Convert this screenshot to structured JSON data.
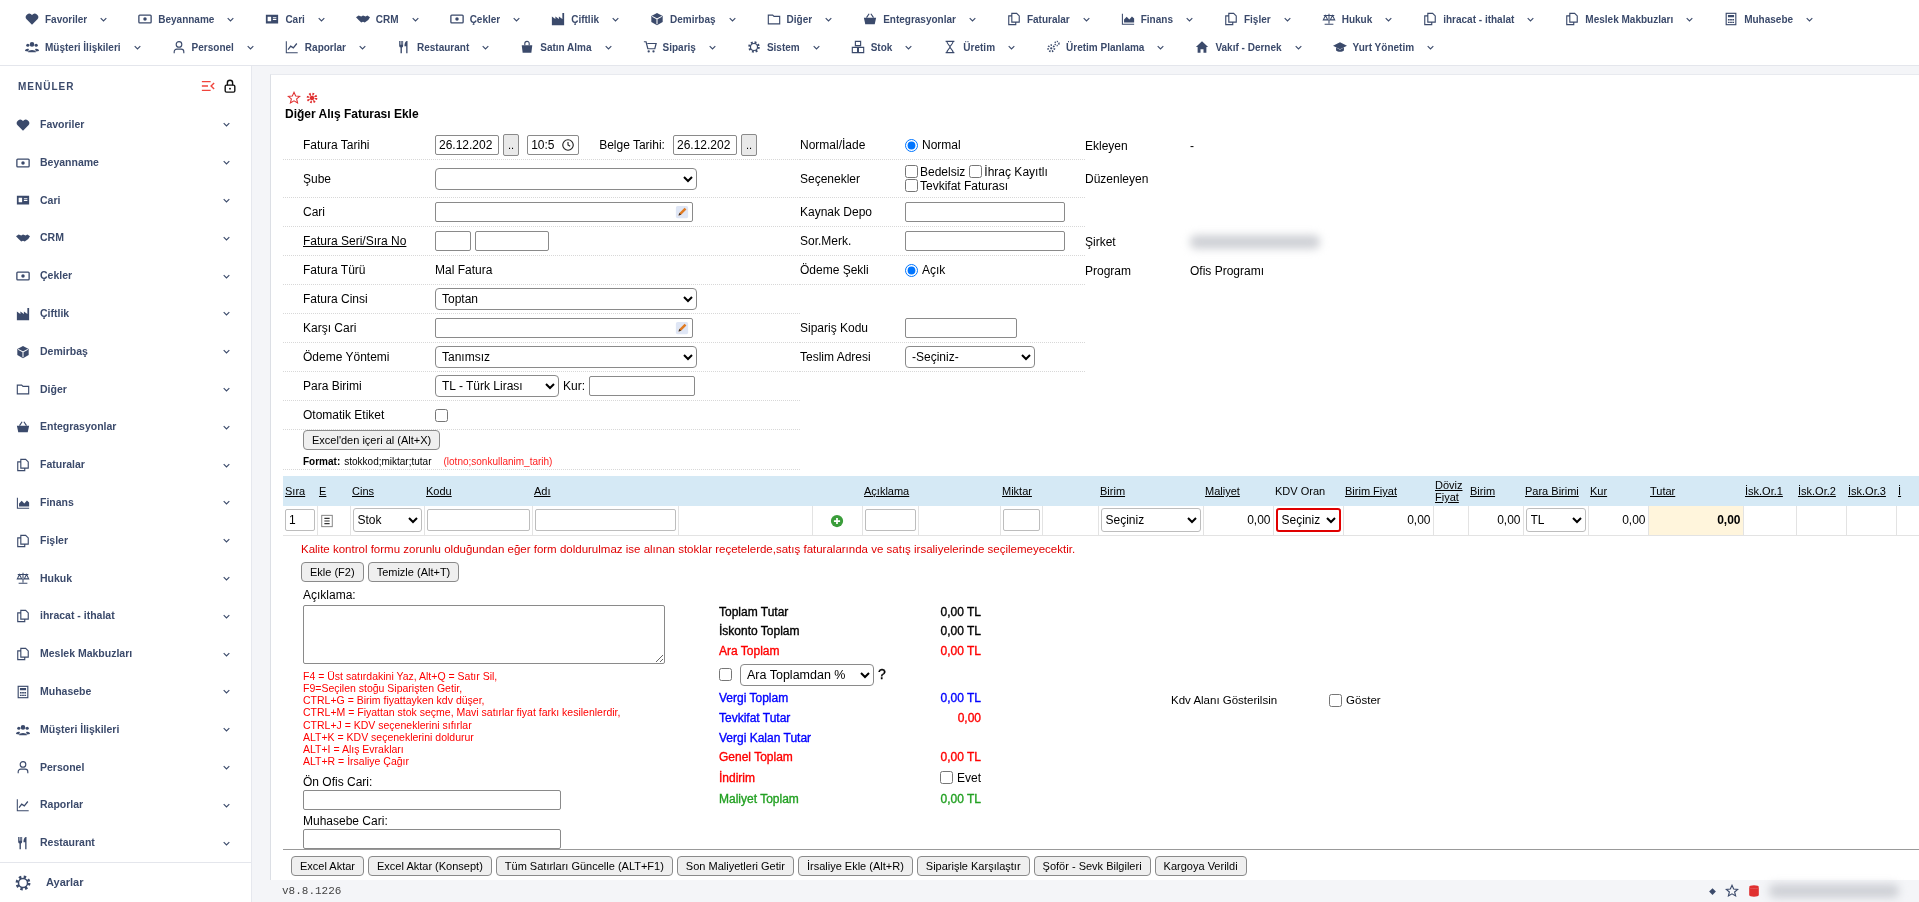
{
  "top_menu": {
    "rows": [
      {
        "items": [
          {
            "label": "Favoriler"
          },
          {
            "label": "Beyanname"
          },
          {
            "label": "Cari"
          },
          {
            "label": "CRM"
          },
          {
            "label": "Çekler"
          },
          {
            "label": "Çiftlik"
          },
          {
            "label": "Demirbaş"
          },
          {
            "label": "Diğer"
          },
          {
            "label": "Entegrasyonlar"
          },
          {
            "label": "Faturalar"
          },
          {
            "label": "Finans"
          },
          {
            "label": "Fişler"
          },
          {
            "label": "Hukuk"
          },
          {
            "label": "ihracat - ithalat"
          },
          {
            "label": "Meslek Makbuzları"
          },
          {
            "label": "Muhasebe"
          }
        ]
      },
      {
        "items": [
          {
            "label": "Müşteri İlişkileri"
          },
          {
            "label": "Personel"
          },
          {
            "label": "Raporlar"
          },
          {
            "label": "Restaurant"
          },
          {
            "label": "Satın Alma"
          },
          {
            "label": "Sipariş"
          },
          {
            "label": "Sistem"
          },
          {
            "label": "Stok"
          },
          {
            "label": "Üretim"
          },
          {
            "label": "Üretim Planlama"
          },
          {
            "label": "Vakıf - Dernek"
          },
          {
            "label": "Yurt Yönetim"
          }
        ]
      }
    ]
  },
  "sidebar": {
    "title": "MENÜLER",
    "items": [
      {
        "label": "Favoriler"
      },
      {
        "label": "Beyanname"
      },
      {
        "label": "Cari"
      },
      {
        "label": "CRM"
      },
      {
        "label": "Çekler"
      },
      {
        "label": "Çiftlik"
      },
      {
        "label": "Demirbaş"
      },
      {
        "label": "Diğer"
      },
      {
        "label": "Entegrasyonlar"
      },
      {
        "label": "Faturalar"
      },
      {
        "label": "Finans"
      },
      {
        "label": "Fişler"
      },
      {
        "label": "Hukuk"
      },
      {
        "label": "ihracat - ithalat"
      },
      {
        "label": "Meslek Makbuzları"
      },
      {
        "label": "Muhasebe"
      },
      {
        "label": "Müşteri İlişkileri"
      },
      {
        "label": "Personel"
      },
      {
        "label": "Raporlar"
      },
      {
        "label": "Restaurant"
      }
    ],
    "footer": {
      "label": "Ayarlar"
    }
  },
  "form": {
    "title": "Diğer Alış Faturası Ekle",
    "header_rows": [
      {
        "left": {
          "label": "Fatura Tarihi",
          "control": {
            "kind": "date_time",
            "date": "26.12.202",
            "button": "..",
            "time": "10:5",
            "second_label": "Belge Tarihi:",
            "second_date": "26.12.202",
            "second_button": ".."
          }
        },
        "middle": {
          "label": "Normal/İade",
          "control": {
            "kind": "radio",
            "option": "Normal",
            "selected": true
          }
        },
        "right": {
          "label": "Ekleyen",
          "value": "-"
        }
      },
      {
        "left": {
          "label": "Şube",
          "control": {
            "kind": "select_blurred"
          }
        },
        "middle": {
          "label": "Seçenekler",
          "control": {
            "kind": "checkboxes",
            "options": [
              {
                "label": "Bedelsiz",
                "checked": false
              },
              {
                "label": "İhraç Kayıtlı",
                "checked": false
              },
              {
                "label": "Tevkifat Faturası",
                "checked": false
              }
            ]
          }
        },
        "right": {
          "label": "Düzenleyen"
        }
      },
      {
        "left": {
          "label": "Cari",
          "control": {
            "kind": "lookup"
          }
        },
        "middle": {
          "label": "Kaynak Depo",
          "control": {
            "kind": "blurred_input"
          }
        }
      },
      {
        "left": {
          "label": "Fatura Seri/Sıra No",
          "link": true,
          "control": {
            "kind": "pair_inputs"
          }
        },
        "middle": {
          "label": "Sor.Merk.",
          "control": {
            "kind": "blurred_input"
          }
        },
        "right": {
          "label": "Şirket",
          "control": {
            "kind": "blurred_text"
          }
        }
      },
      {
        "left": {
          "label": "Fatura Türü",
          "control": {
            "kind": "text",
            "value": "Mal Fatura"
          }
        },
        "middle": {
          "label": "Ödeme Şekli",
          "control": {
            "kind": "radio",
            "option": "Açık",
            "selected": true
          }
        },
        "right": {
          "label": "Program",
          "value": "Ofis Programı"
        }
      },
      {
        "left": {
          "label": "Fatura Cinsi",
          "control": {
            "kind": "select",
            "value": "Toptan"
          }
        }
      },
      {
        "left": {
          "label": "Karşı Cari",
          "control": {
            "kind": "lookup"
          }
        },
        "middle": {
          "label": "Sipariş Kodu",
          "control": {
            "kind": "input"
          }
        }
      },
      {
        "left": {
          "label": "Ödeme Yöntemi",
          "control": {
            "kind": "select",
            "value": "Tanımsız"
          }
        },
        "middle": {
          "label": "Teslim Adresi",
          "control": {
            "kind": "select",
            "value": "-Seçiniz-"
          }
        }
      },
      {
        "left": {
          "label": "Para Birimi",
          "control": {
            "kind": "currency",
            "value": "TL - Türk Lirası",
            "rate_label": "Kur:"
          }
        }
      },
      {
        "left": {
          "label": "Otomatik Etiket",
          "control": {
            "kind": "checkbox",
            "checked": false
          }
        }
      }
    ],
    "import_button": "Excel'den içeri al (Alt+X)",
    "format": {
      "label": "Format:",
      "text": "stokkod;miktar;tutar",
      "extra": "(lotno;sonkullanim_tarih)"
    }
  },
  "line_items": {
    "columns": [
      {
        "label": "Sıra",
        "link": true
      },
      {
        "label": "E",
        "link": true
      },
      {
        "label": "Cins",
        "link": true
      },
      {
        "label": "Kodu",
        "link": true
      },
      {
        "label": "Adı",
        "link": true
      },
      {},
      {},
      {
        "label": "Açıklama",
        "link": true
      },
      {},
      {
        "label": "Miktar",
        "link": true
      },
      {},
      {
        "label": "Birim",
        "link": true
      },
      {
        "label": "Maliyet",
        "link": true
      },
      {
        "label": "KDV Oran",
        "link": false
      },
      {
        "label": "Birim Fiyat",
        "link": true
      },
      {
        "label": "Döviz Fiyat",
        "link": true
      },
      {
        "label": "Birim",
        "link": true
      },
      {
        "label": "Para Birimi",
        "link": true
      },
      {
        "label": "Kur",
        "link": true
      },
      {
        "label": "Tutar",
        "link": true
      },
      {
        "label": "İsk.Or.1",
        "link": true
      },
      {
        "label": "İsk.Or.2",
        "link": true
      },
      {
        "label": "İsk.Or.3",
        "link": true
      },
      {
        "label": "İ",
        "link": true
      }
    ],
    "rows": [
      {
        "cells": [
          {
            "kind": "input",
            "value": "1"
          },
          {
            "kind": "icon_button"
          },
          {
            "kind": "select",
            "value": "Stok"
          },
          {
            "kind": "input"
          },
          {
            "kind": "input"
          },
          {
            "kind": "empty"
          },
          {
            "kind": "add_button"
          },
          {
            "kind": "input"
          },
          {
            "kind": "empty"
          },
          {
            "kind": "input"
          },
          {
            "kind": "empty"
          },
          {
            "kind": "select",
            "value": "Seçiniz"
          },
          {
            "kind": "number",
            "value": "0,00"
          },
          {
            "kind": "select",
            "value": "Seçiniz",
            "highlighted": true
          },
          {
            "kind": "number",
            "value": "0,00"
          },
          {
            "kind": "empty"
          },
          {
            "kind": "number",
            "value": "0,00"
          },
          {
            "kind": "select",
            "value": "TL"
          },
          {
            "kind": "number",
            "value": "0,00"
          },
          {
            "kind": "total",
            "value": "0,00"
          },
          {
            "kind": "empty"
          },
          {
            "kind": "empty"
          },
          {
            "kind": "empty"
          },
          {
            "kind": "empty"
          }
        ]
      }
    ]
  },
  "warning": "Kalite kontrol formu zorunlu olduğundan eğer form doldurulmaz ise alınan stoklar reçetelerde,satış faturalarında ve satış irsaliyelerinde seçilemeyecektir.",
  "row_buttons": [
    "Ekle (F2)",
    "Temizle (Alt+T)"
  ],
  "notes": {
    "label": "Açıklama:",
    "help_lines": [
      "F4 = Üst satırdakini Yaz, Alt+Q = Satır Sil,",
      "F9=Seçilen stoğu Siparişten Getir,",
      "CTRL+G = Birim fiyattayken kdv düşer,",
      "CTRL+M = Fiyattan stok seçme, Mavi satırlar fiyat farkı kesilenlerdir,",
      "CTRL+J = KDV seçeneklerini sıfırlar",
      "ALT+K = KDV seçeneklerini doldurur",
      "ALT+I = Alış Evrakları",
      "ALT+R = İrsaliye Çağır"
    ],
    "fields": [
      {
        "label": "Ön Ofis Cari:"
      },
      {
        "label": "Muhasebe Cari:"
      }
    ]
  },
  "totals": [
    {
      "kind": "amount",
      "label": "Toplam Tutar",
      "color": "#000000",
      "value": {
        "text": "0,00 TL",
        "color": "#000000"
      }
    },
    {
      "kind": "amount",
      "label": "İskonto Toplam",
      "color": "#000000",
      "value": {
        "text": "0,00 TL",
        "color": "#000000"
      }
    },
    {
      "kind": "amount",
      "label": "Ara Toplam",
      "color": "#ff0000",
      "value": {
        "text": "0,00 TL",
        "color": "#ff0000"
      }
    },
    {
      "kind": "discount_select",
      "checked": false,
      "option": "Ara Toplamdan %",
      "hint": "?"
    },
    {
      "kind": "amount",
      "label": "Vergi Toplam",
      "color": "#0000ff",
      "value": {
        "text": "0,00 TL",
        "color": "#0000ff"
      }
    },
    {
      "kind": "amount",
      "label": "Tevkifat Tutar",
      "color": "#0000ff",
      "value": {
        "text": "0,00",
        "color": "#ff0000"
      }
    },
    {
      "kind": "amount",
      "label": "Vergi Kalan Tutar",
      "color": "#0000ff"
    },
    {
      "kind": "amount",
      "label": "Genel Toplam",
      "color": "#ff0000",
      "value": {
        "text": "0,00 TL",
        "color": "#ff0000"
      }
    },
    {
      "kind": "check",
      "label": "İndirim",
      "option": "Evet",
      "checked": false,
      "color": "#ff0000"
    },
    {
      "kind": "amount",
      "label": "Maliyet Toplam",
      "color": "#22a022",
      "value": {
        "text": "0,00 TL",
        "color": "#22a022"
      }
    }
  ],
  "kdv_option": {
    "label": "Kdv Alanı Gösterilsin",
    "option": "Göster",
    "checked": false
  },
  "action_buttons": [
    "Excel Aktar",
    "Excel Aktar (Konsept)",
    "Tüm Satırları Güncelle (ALT+F1)",
    "Son Maliyetleri Getir",
    "İrsaliye Ekle (Alt+R)",
    "Siparişle Karşılaştır",
    "Şoför - Sevk Bilgileri",
    "Kargoya Verildi"
  ],
  "footer": {
    "version": "v8.8.1226"
  }
}
